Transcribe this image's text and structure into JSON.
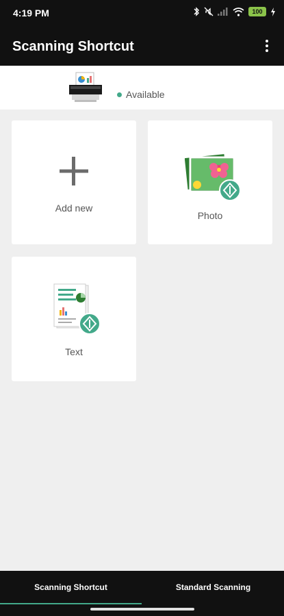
{
  "status_bar": {
    "time": "4:19 PM",
    "battery": "100"
  },
  "app_bar": {
    "title": "Scanning Shortcut"
  },
  "device": {
    "status": "Available"
  },
  "tiles": [
    {
      "label": "Add new"
    },
    {
      "label": "Photo"
    },
    {
      "label": "Text"
    }
  ],
  "bottom_nav": {
    "tabs": [
      {
        "label": "Scanning Shortcut",
        "selected": true
      },
      {
        "label": "Standard Scanning",
        "selected": false
      }
    ]
  },
  "colors": {
    "accent": "#43a98a",
    "bar": "#111111",
    "background": "#efefef"
  }
}
